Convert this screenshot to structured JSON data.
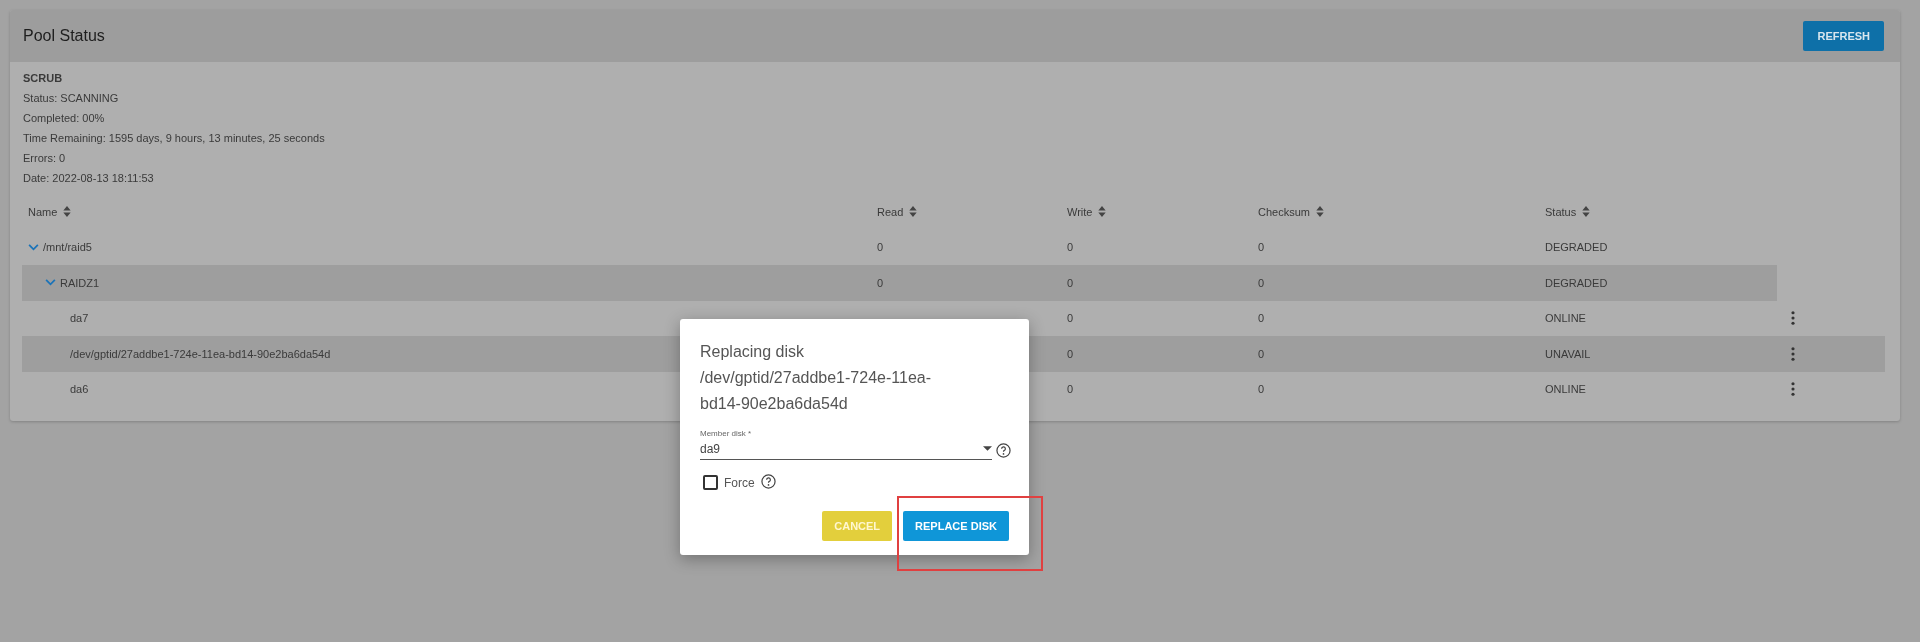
{
  "panel": {
    "title": "Pool Status",
    "refresh_button": "REFRESH"
  },
  "scrub": {
    "heading": "SCRUB",
    "lines": [
      "Status: SCANNING",
      "Completed: 00%",
      "Time Remaining: 1595 days, 9 hours, 13 minutes, 25 seconds",
      "Errors: 0",
      "Date: 2022-08-13 18:11:53"
    ]
  },
  "table": {
    "columns": [
      "Name",
      "Read",
      "Write",
      "Checksum",
      "Status"
    ],
    "rows": [
      {
        "name": "/mnt/raid5",
        "read": "0",
        "write": "0",
        "checksum": "0",
        "status": "DEGRADED",
        "expanded": true,
        "children": [
          {
            "name": "RAIDZ1",
            "read": "0",
            "write": "0",
            "checksum": "0",
            "status": "DEGRADED",
            "expanded": true,
            "children": [
              {
                "name": "da7",
                "write": "0",
                "checksum": "0",
                "status": "ONLINE"
              },
              {
                "name": "/dev/gptid/27addbe1-724e-11ea-bd14-90e2ba6da54d",
                "write": "0",
                "checksum": "0",
                "status": "UNAVAIL"
              },
              {
                "name": "da6",
                "write": "0",
                "checksum": "0",
                "status": "ONLINE"
              }
            ]
          }
        ]
      }
    ]
  },
  "dialog": {
    "title": "Replacing disk /dev/gptid/27addbe1-724e-11ea-bd14-90e2ba6da54d",
    "member_disk": {
      "label": "Member disk *",
      "value": "da9"
    },
    "force": {
      "label": "Force",
      "checked": false
    },
    "buttons": [
      {
        "label": "CANCEL",
        "kind": "cancel"
      },
      {
        "label": "REPLACE DISK",
        "kind": "primary"
      }
    ]
  }
}
